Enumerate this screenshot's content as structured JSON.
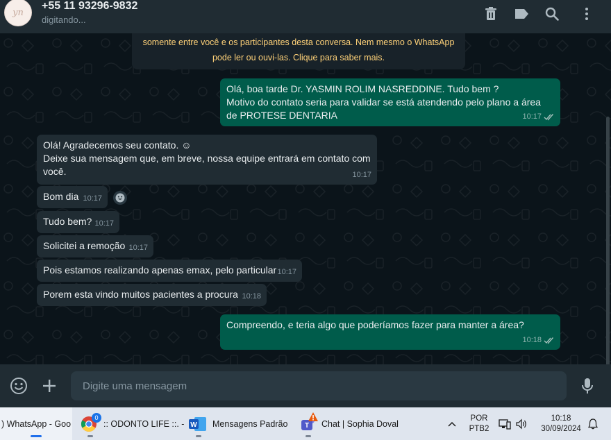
{
  "header": {
    "avatar_text": "yn",
    "contact_name": "+55 11 93296-9832",
    "status": "digitando...",
    "icons": [
      "trash-icon",
      "label-icon",
      "search-icon",
      "more-vert-icon"
    ]
  },
  "encryption_notice": {
    "line1": "somente entre você e os participantes desta conversa. Nem mesmo o WhatsApp",
    "line2": "pode ler ou ouvi-las. Clique para saber mais."
  },
  "messages": [
    {
      "dir": "out",
      "lines": [
        "Olá, boa tarde Dr. YASMIN ROLIM NASREDDINE. Tudo bem ?",
        "Motivo do contato seria para validar se está atendendo pelo plano a área",
        "de PROTESE DENTARIA"
      ],
      "time": "10:17",
      "read": true
    },
    {
      "dir": "in",
      "lines": [
        "Olá! Agradecemos seu contato. ☺",
        "Deixe sua mensagem que, em breve, nossa equipe entrará em contato com",
        "você."
      ],
      "time": "10:17"
    },
    {
      "dir": "in",
      "lines": [
        "Bom dia"
      ],
      "time": "10:17"
    },
    {
      "dir": "in",
      "lines": [
        "Tudo bem?"
      ],
      "time": "10:17"
    },
    {
      "dir": "in",
      "lines": [
        "Solicitei a remoção"
      ],
      "time": "10:17"
    },
    {
      "dir": "in",
      "lines": [
        "Pois estamos realizando apenas emax, pelo particular"
      ],
      "time": "10:17"
    },
    {
      "dir": "in",
      "lines": [
        "Porem esta vindo muitos pacientes a procura"
      ],
      "time": "10:18"
    },
    {
      "dir": "out",
      "lines": [
        "Compreendo, e teria algo que poderíamos fazer para manter a área?"
      ],
      "time": "10:18",
      "read": true
    }
  ],
  "compose": {
    "placeholder": "Digite uma mensagem",
    "icons": [
      "emoji-icon",
      "plus-icon",
      "mic-icon"
    ]
  },
  "taskbar": {
    "items": [
      {
        "label": ") WhatsApp - Goo"
      },
      {
        "label": ":: ODONTO LIFE ::. -",
        "badge": "0"
      },
      {
        "label": "Mensagens Padrão"
      },
      {
        "label": "Chat | Sophia Doval"
      }
    ],
    "lang_line1": "POR",
    "lang_line2": "PTB2",
    "time": "10:18",
    "date": "30/09/2024"
  },
  "colors": {
    "incoming_bubble": "#202c33",
    "outgoing_bubble": "#005c4b",
    "chat_bg": "#0b141a",
    "encryption_text": "#ffd279"
  }
}
